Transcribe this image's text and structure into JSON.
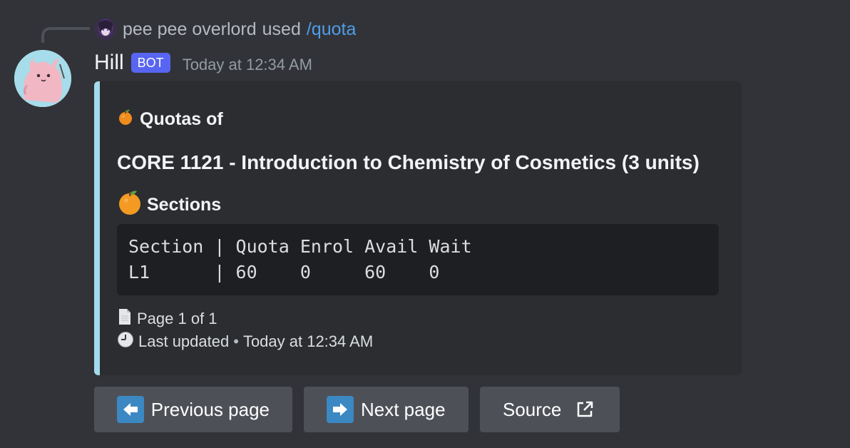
{
  "reply": {
    "user": "pee pee overlord",
    "verb": "used",
    "command": "/quota"
  },
  "author": {
    "name": "Hill",
    "tag": "BOT",
    "timestamp": "Today at 12:34 AM"
  },
  "embed": {
    "accent_color": "#a3dbec",
    "author_icon": "tangerine-emoji",
    "author_text": "Quotas of",
    "title": "CORE 1121 - Introduction to Chemistry of Cosmetics (3 units)",
    "field_icon": "tangerine-emoji",
    "field_name": "Sections",
    "table": {
      "header": "Section | Quota Enrol Avail Wait",
      "rows": [
        "L1      | 60    0     60    0"
      ]
    },
    "footer": {
      "page_icon": "page-icon",
      "page_text": "Page 1 of 1",
      "clock_icon": "clock-icon",
      "updated_label": "Last updated",
      "separator": "•",
      "updated_time": "Today at 12:34 AM"
    }
  },
  "buttons": {
    "previous": {
      "icon": "left-arrow-icon",
      "label": "Previous page"
    },
    "next": {
      "icon": "right-arrow-icon",
      "label": "Next page"
    },
    "source": {
      "icon": "external-link-icon",
      "label": "Source"
    }
  },
  "colors": {
    "background": "#313338",
    "embed_bg": "#2b2d31",
    "bot_tag": "#5865f2",
    "button_bg": "#4e5058",
    "command_link": "#4f9de8"
  }
}
